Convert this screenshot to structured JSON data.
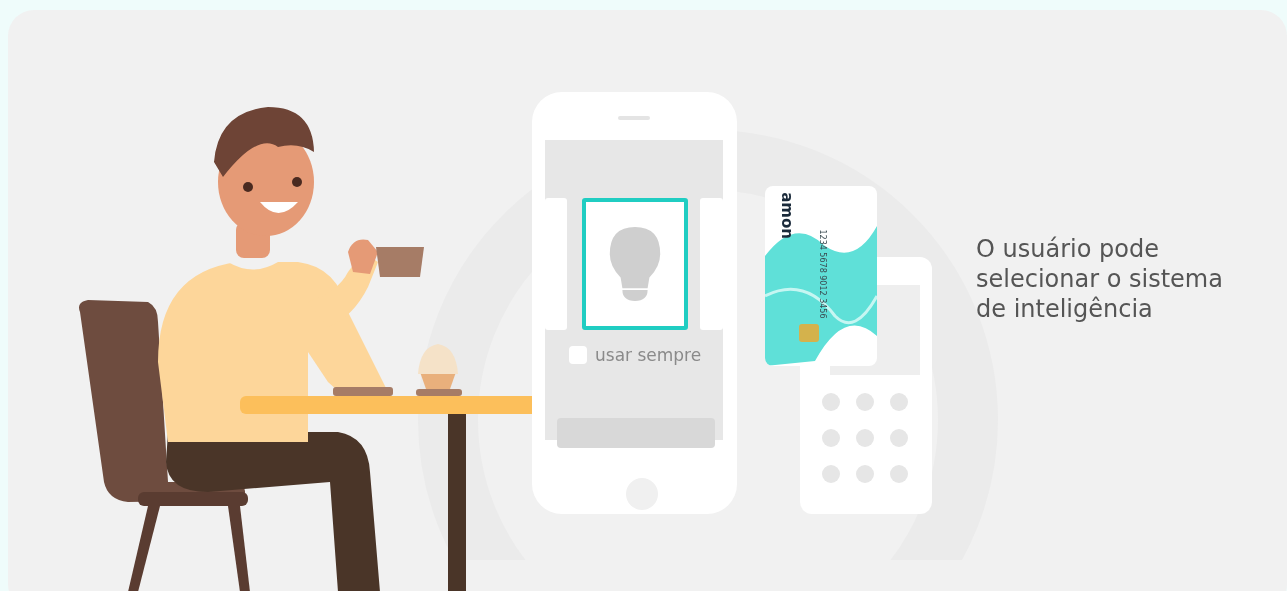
{
  "phone": {
    "options": [
      {
        "selected": false
      },
      {
        "selected": true
      },
      {
        "selected": false
      }
    ],
    "checkbox": {
      "label": "usar sempre",
      "checked": false
    }
  },
  "card": {
    "brand": "amon",
    "number": "1234 5678 9012 3456"
  },
  "caption": "O usuário pode selecionar o sistema de inteligência"
}
